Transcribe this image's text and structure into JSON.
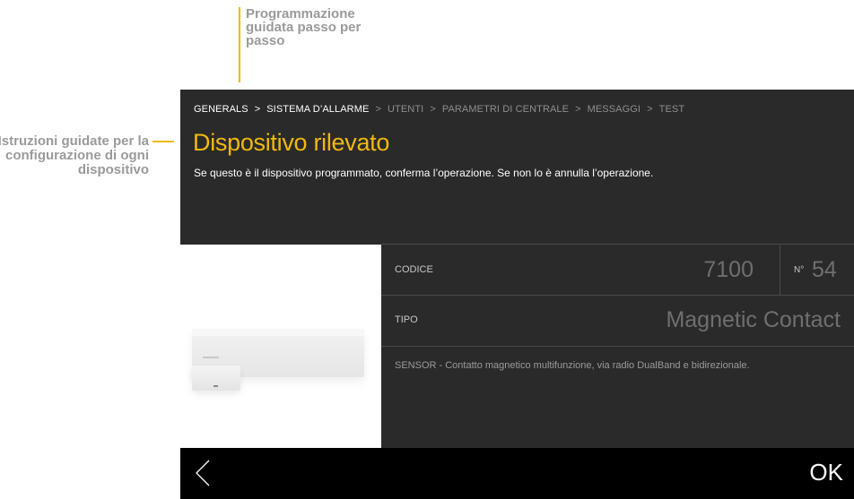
{
  "callouts": {
    "top": "Programmazione guidata passo per passo",
    "left": "Istruzioni guidate per la configurazione di ogni dispositivo"
  },
  "breadcrumb": [
    {
      "label": "GENERALS",
      "state": "active"
    },
    {
      "label": "SISTEMA D’ALLARME",
      "state": "active"
    },
    {
      "label": "UTENTI",
      "state": "inactive"
    },
    {
      "label": "PARAMETRI DI CENTRALE",
      "state": "inactive"
    },
    {
      "label": "MESSAGGI",
      "state": "inactive"
    },
    {
      "label": "TEST",
      "state": "inactive"
    }
  ],
  "breadcrumb_separator": ">",
  "screen": {
    "title": "Dispositivo rilevato",
    "description": "Se questo è il dispositivo programmato, conferma l’operazione. Se non lo è annulla l’operazione."
  },
  "device": {
    "codice_label": "CODICE",
    "codice_value": "7100",
    "number_label": "N°",
    "number_value": "54",
    "tipo_label": "TIPO",
    "tipo_value": "Magnetic Contact",
    "details": "SENSOR - Contatto magnetico multifunzione, via radio DualBand e bidirezionale."
  },
  "footer": {
    "back_icon": "chevron-left-icon",
    "ok_label": "OK"
  },
  "colors": {
    "accent": "#f2b90b",
    "screen_bg": "#2a2a2a",
    "footer_bg": "#000000"
  }
}
